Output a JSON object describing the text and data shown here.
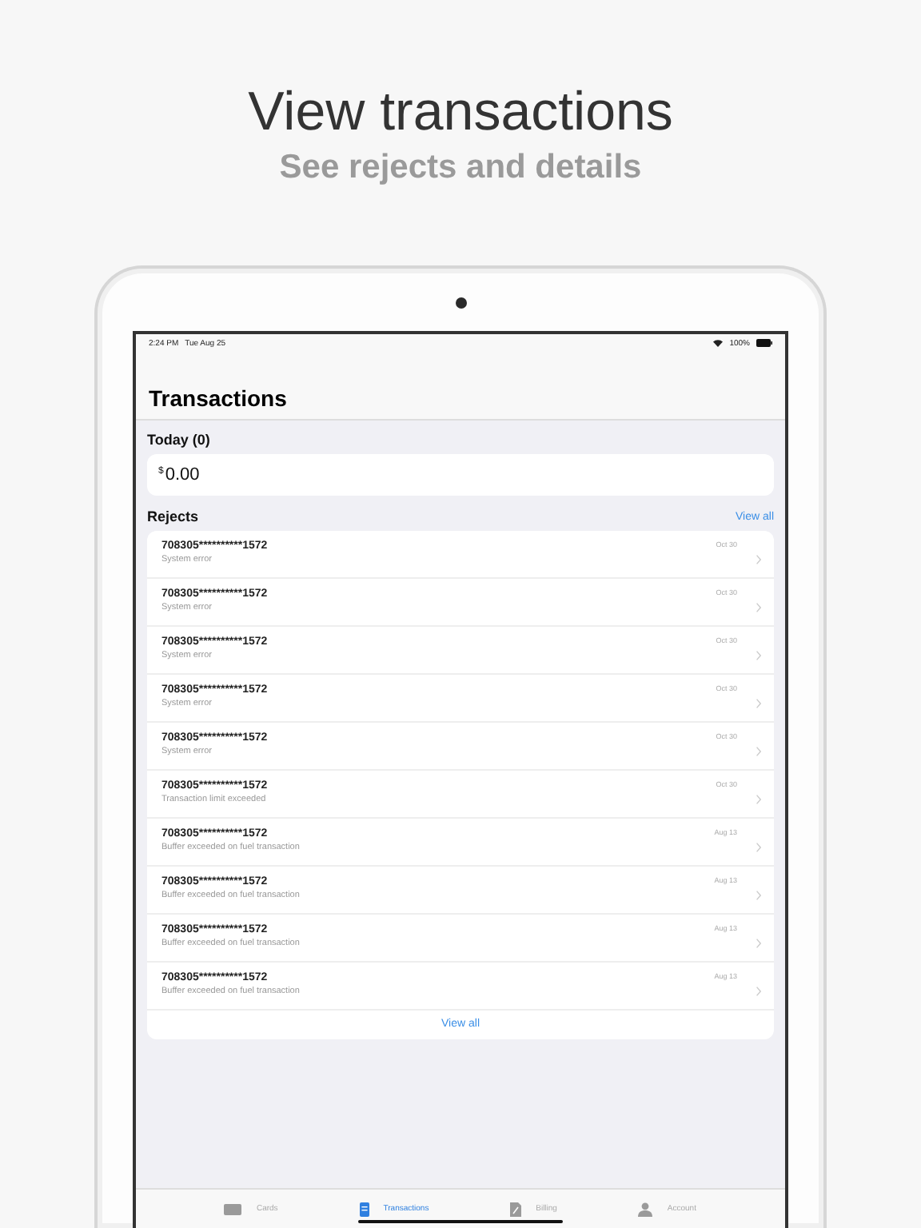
{
  "headline": "View transactions",
  "subheadline": "See rejects and details",
  "status_bar": {
    "time": "2:24 PM",
    "date": "Tue Aug 25",
    "battery": "100%"
  },
  "title": "Transactions",
  "today": {
    "label": "Today (0)",
    "currency": "$",
    "amount": "0.00"
  },
  "rejects": {
    "label": "Rejects",
    "view_all_top": "View all",
    "view_all_bottom": "View all",
    "rows": [
      {
        "card": "708305**********1572",
        "reason": "System error",
        "date": "Oct 30"
      },
      {
        "card": "708305**********1572",
        "reason": "System error",
        "date": "Oct 30"
      },
      {
        "card": "708305**********1572",
        "reason": "System error",
        "date": "Oct 30"
      },
      {
        "card": "708305**********1572",
        "reason": "System error",
        "date": "Oct 30"
      },
      {
        "card": "708305**********1572",
        "reason": "System error",
        "date": "Oct 30"
      },
      {
        "card": "708305**********1572",
        "reason": "Transaction limit exceeded",
        "date": "Oct 30"
      },
      {
        "card": "708305**********1572",
        "reason": "Buffer exceeded on fuel transaction",
        "date": "Aug 13"
      },
      {
        "card": "708305**********1572",
        "reason": "Buffer exceeded on fuel transaction",
        "date": "Aug 13"
      },
      {
        "card": "708305**********1572",
        "reason": "Buffer exceeded on fuel transaction",
        "date": "Aug 13"
      },
      {
        "card": "708305**********1572",
        "reason": "Buffer exceeded on fuel transaction",
        "date": "Aug 13"
      }
    ]
  },
  "tabs": [
    {
      "kind": "cards",
      "label": "Cards",
      "selected": false
    },
    {
      "kind": "transactions",
      "label": "Transactions",
      "selected": true
    },
    {
      "kind": "billing",
      "label": "Billing",
      "selected": false
    },
    {
      "kind": "account",
      "label": "Account",
      "selected": false
    }
  ]
}
